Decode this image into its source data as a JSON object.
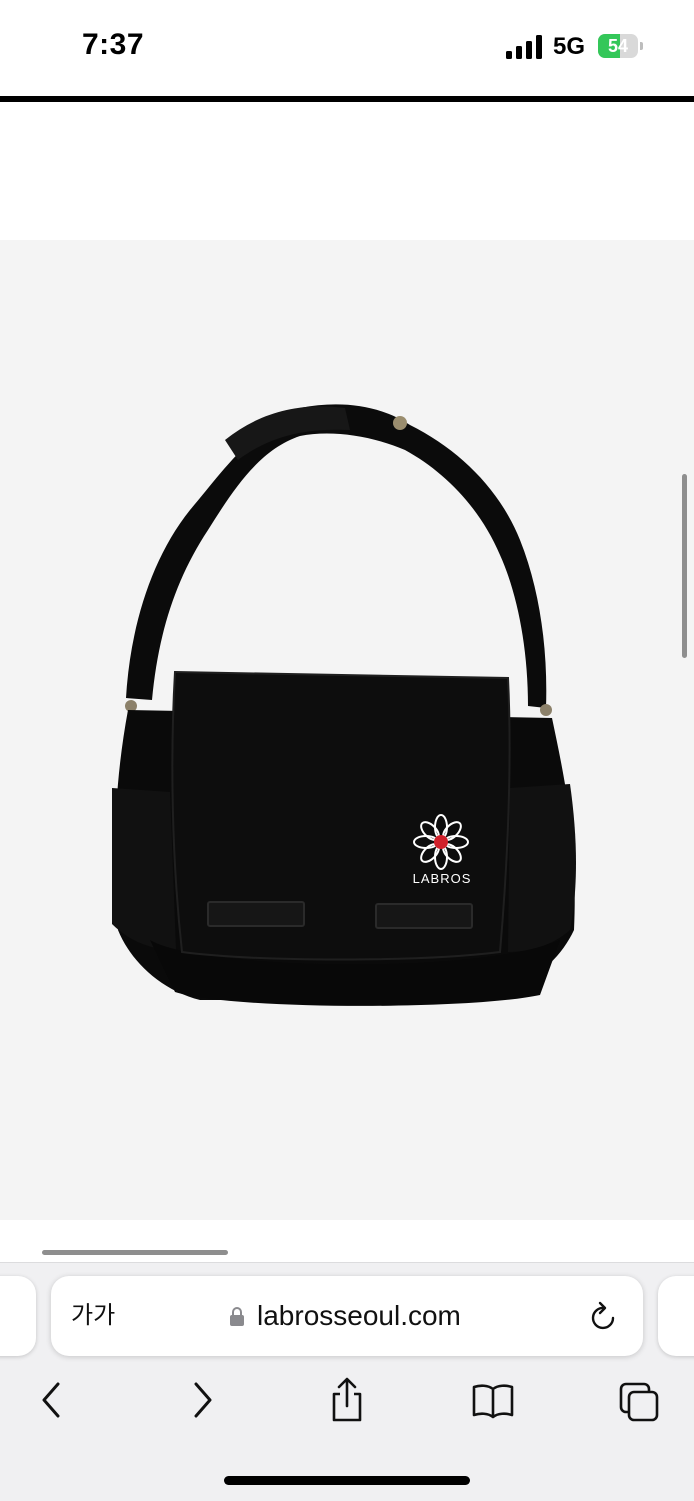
{
  "status_bar": {
    "time": "7:37",
    "network": "5G",
    "battery": "54",
    "battery_fraction": 0.54
  },
  "browser": {
    "reader_label": "가가",
    "url": "labrosseoul.com"
  },
  "product": {
    "brand_embroidery": "LABROS"
  },
  "colors": {
    "product_background": "#f4f4f4",
    "battery_green": "#34c759",
    "toolbar_background": "#f0f0f2"
  },
  "icons": {
    "toolbar": [
      "back-icon",
      "forward-icon",
      "share-icon",
      "bookmarks-icon",
      "tabs-icon"
    ],
    "address": [
      "lock-icon",
      "reload-icon"
    ]
  }
}
